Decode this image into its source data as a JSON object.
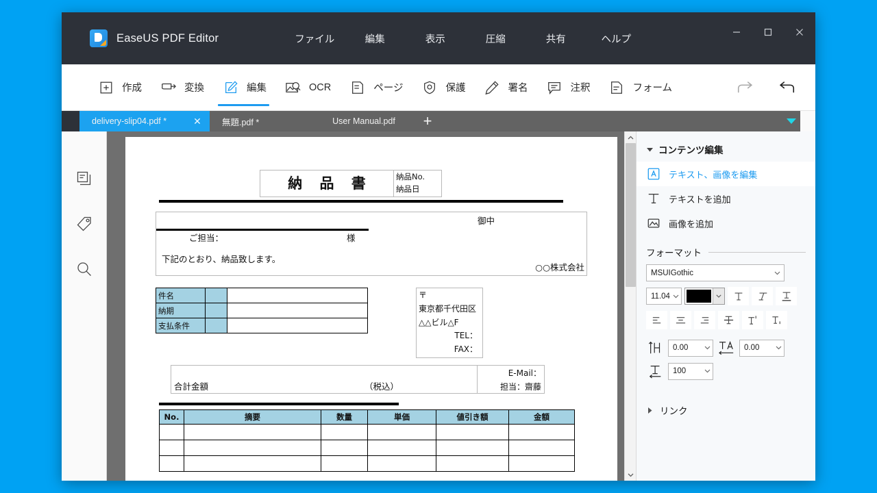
{
  "window": {
    "app_title": "EaseUS PDF Editor",
    "logo_icon": "easeus-pdf-logo-icon",
    "controls": {
      "minimize": "minimize-icon",
      "maximize": "maximize-icon",
      "close": "close-icon"
    }
  },
  "menu": {
    "items": [
      {
        "label": "ファイル"
      },
      {
        "label": "編集"
      },
      {
        "label": "表示"
      },
      {
        "label": "圧縮"
      },
      {
        "label": "共有"
      },
      {
        "label": "ヘルプ"
      }
    ]
  },
  "ribbon": {
    "tools": [
      {
        "label": "作成",
        "icon": "plus-box-icon",
        "active": false
      },
      {
        "label": "変換",
        "icon": "convert-arrow-icon",
        "active": false
      },
      {
        "label": "編集",
        "icon": "pencil-page-icon",
        "active": true
      },
      {
        "label": "OCR",
        "icon": "ocr-scan-icon",
        "active": false
      },
      {
        "label": "ページ",
        "icon": "page-lines-icon",
        "active": false
      },
      {
        "label": "保護",
        "icon": "shield-icon",
        "active": false
      },
      {
        "label": "署名",
        "icon": "signature-pen-icon",
        "active": false
      },
      {
        "label": "注釈",
        "icon": "comment-icon",
        "active": false
      },
      {
        "label": "フォーム",
        "icon": "form-icon",
        "active": false
      }
    ],
    "redo_icon": "redo-arrow-icon",
    "undo_icon": "undo-arrow-icon"
  },
  "tabs": {
    "items": [
      {
        "name": "delivery-slip04.pdf *",
        "active": true
      },
      {
        "name": "無題.pdf *",
        "active": false
      },
      {
        "name": "User Manual.pdf",
        "active": false
      }
    ],
    "add_label": "+",
    "close_label": "✕",
    "overflow_icon": "chevron-down-icon",
    "overflow_color": "#1fd6e8"
  },
  "left_rail": {
    "items": [
      {
        "icon": "pages-thumbnail-icon"
      },
      {
        "icon": "bookmark-tag-icon"
      },
      {
        "icon": "search-icon"
      }
    ]
  },
  "document": {
    "title": "納 品 書",
    "header_fields": [
      "納品No.",
      "納品日"
    ],
    "recipient": {
      "ochu": "御中",
      "tantou_label": "ご担当：",
      "sama": "様"
    },
    "body_text": "下記のとおり、納品致します。",
    "company": "○○株式会社",
    "terms": [
      {
        "label": "件名",
        "value": ""
      },
      {
        "label": "納期",
        "value": ""
      },
      {
        "label": "支払条件",
        "value": ""
      }
    ],
    "address": {
      "postal": "〒",
      "line1": "東京都千代田区",
      "line2": "△△ビル△F",
      "tel": "TEL：",
      "fax": "FAX：",
      "email": "E-Mail：",
      "contact": "担当：齋藤"
    },
    "total": {
      "label": "合計金額",
      "tax_note": "（税込）"
    },
    "items_table": {
      "headers": [
        "No.",
        "摘要",
        "数量",
        "単価",
        "値引き額",
        "金額"
      ],
      "rows": [
        [
          "",
          "",
          "",
          "",
          "",
          ""
        ],
        [
          "",
          "",
          "",
          "",
          "",
          ""
        ],
        [
          "",
          "",
          "",
          "",
          "",
          ""
        ]
      ]
    },
    "header_cell_color": "#a4d2e3"
  },
  "right_panel": {
    "content_section": {
      "title": "コンテンツ編集",
      "expanded": true,
      "items": [
        {
          "label": "テキスト、画像を編集",
          "icon": "edit-text-image-icon",
          "active": true
        },
        {
          "label": "テキストを追加",
          "icon": "add-text-icon",
          "active": false
        },
        {
          "label": "画像を追加",
          "icon": "add-image-icon",
          "active": false
        }
      ]
    },
    "format_section": {
      "title": "フォーマット",
      "font_family": "MSUIGothic",
      "font_size": "11.04",
      "font_color": "#000000",
      "style_buttons": [
        {
          "icon": "bold-text-icon"
        },
        {
          "icon": "italic-text-icon"
        },
        {
          "icon": "underline-text-icon"
        }
      ],
      "align_buttons": [
        {
          "icon": "align-left-icon"
        },
        {
          "icon": "align-center-icon"
        },
        {
          "icon": "align-right-icon"
        },
        {
          "icon": "strikethrough-icon"
        },
        {
          "icon": "superscript-icon"
        },
        {
          "icon": "subscript-icon"
        }
      ],
      "line_spacing": {
        "icon": "line-spacing-icon",
        "value": "0.00"
      },
      "char_spacing": {
        "icon": "char-spacing-icon",
        "value": "0.00"
      },
      "horizontal_scale": {
        "icon": "horizontal-scale-icon",
        "value": "100"
      }
    },
    "link_section": {
      "title": "リンク",
      "expanded": false
    }
  },
  "theme": {
    "desktop": "#00a2f3",
    "titlebar": "#2d3139",
    "accent": "#1d9bf0",
    "tab_active": "#1ca2f0",
    "tabstrip": "#636363",
    "viewport": "#6f6f6f"
  }
}
